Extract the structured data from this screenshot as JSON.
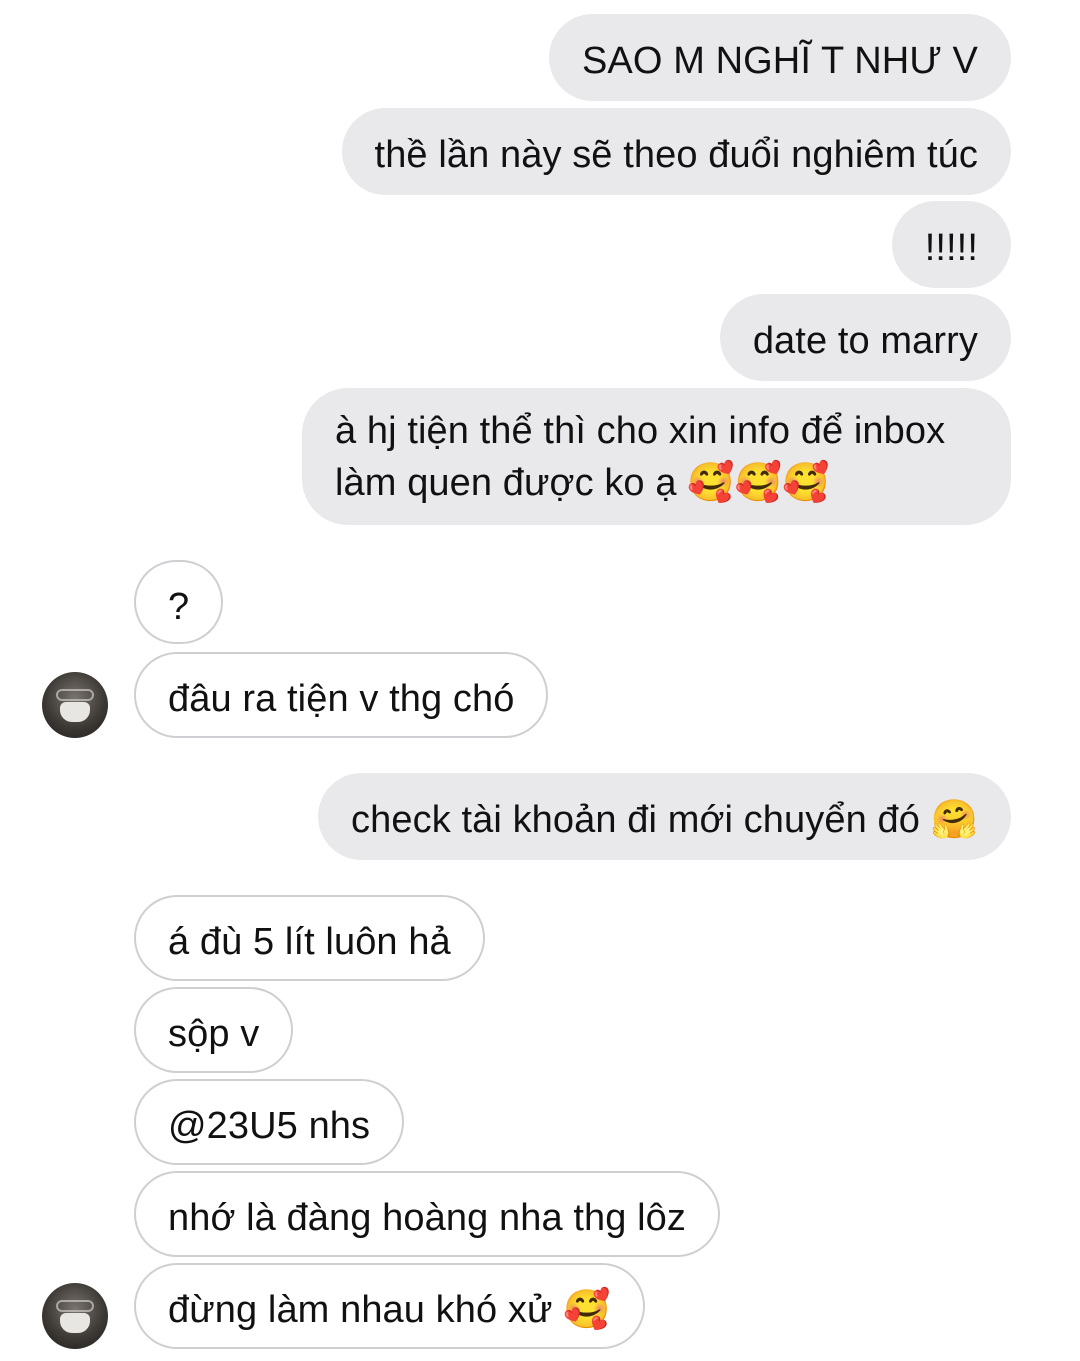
{
  "messages": [
    {
      "side": "sent",
      "text": "SAO M NGHĨ T NHƯ V"
    },
    {
      "side": "sent",
      "text": "thề lần này sẽ theo đuổi nghiêm túc"
    },
    {
      "side": "sent",
      "text": "!!!!!"
    },
    {
      "side": "sent",
      "text": "date to marry"
    },
    {
      "side": "sent",
      "text": "à hj tiện thể thì cho xin info để inbox làm quen được ko ạ 🥰🥰🥰"
    },
    {
      "side": "received",
      "text": "?"
    },
    {
      "side": "received",
      "text": "đâu ra tiện v thg chó"
    },
    {
      "side": "sent",
      "text": "check tài khoản đi mới chuyển đó 🤗"
    },
    {
      "side": "received",
      "text": "á đù 5 lít luôn hả"
    },
    {
      "side": "received",
      "text": "sộp v"
    },
    {
      "side": "received",
      "text": "@23U5 nhs"
    },
    {
      "side": "received",
      "text": "nhớ là đàng hoàng nha thg lôz"
    },
    {
      "side": "received",
      "text": "đừng làm nhau khó xử 🥰"
    }
  ],
  "colors": {
    "sent_bubble": "#e9e9ec",
    "received_border": "#cfcfd3",
    "text": "#111111",
    "background": "#ffffff"
  },
  "icons": {
    "avatar": "contact-avatar"
  }
}
